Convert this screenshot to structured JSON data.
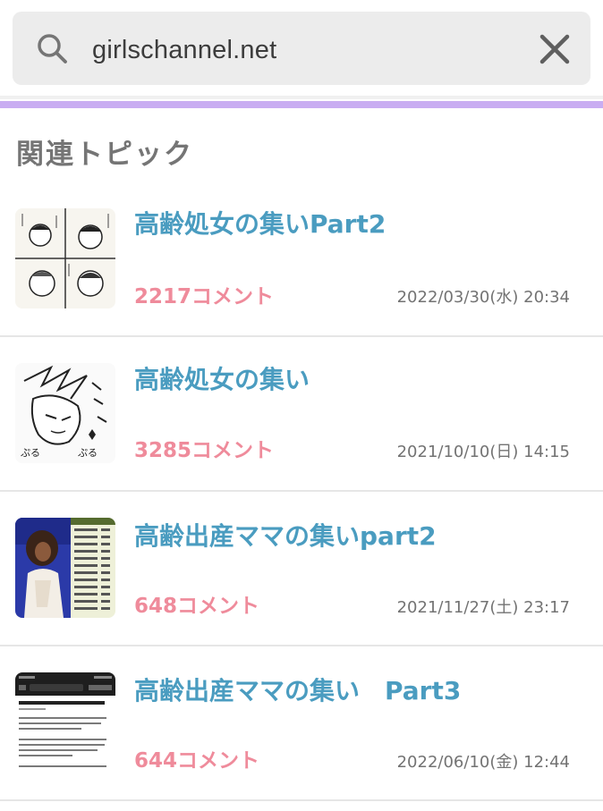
{
  "search": {
    "value": "girlschannel.net"
  },
  "section": {
    "title": "関連トピック"
  },
  "topics": [
    {
      "title": "高齢処女の集いPart2",
      "comments": "2217コメント",
      "date": "2022/03/30(水) 20:34",
      "thumbnail_icon": "manga-panel-thumbnail"
    },
    {
      "title": "高齢処女の集い",
      "comments": "3285コメント",
      "date": "2021/10/10(日) 14:15",
      "thumbnail_icon": "manga-sketch-thumbnail"
    },
    {
      "title": "高齢出産ママの集いpart2",
      "comments": "648コメント",
      "date": "2021/11/27(土) 23:17",
      "thumbnail_icon": "photo-and-list-thumbnail"
    },
    {
      "title": "高齢出産ママの集い　Part3",
      "comments": "644コメント",
      "date": "2022/06/10(金) 12:44",
      "thumbnail_icon": "article-screenshot-thumbnail"
    }
  ],
  "colors": {
    "accent_purple": "#c9adf2",
    "title_blue": "#4a9cc0",
    "comment_pink": "#ef8b9b",
    "search_bg": "#ececec"
  }
}
